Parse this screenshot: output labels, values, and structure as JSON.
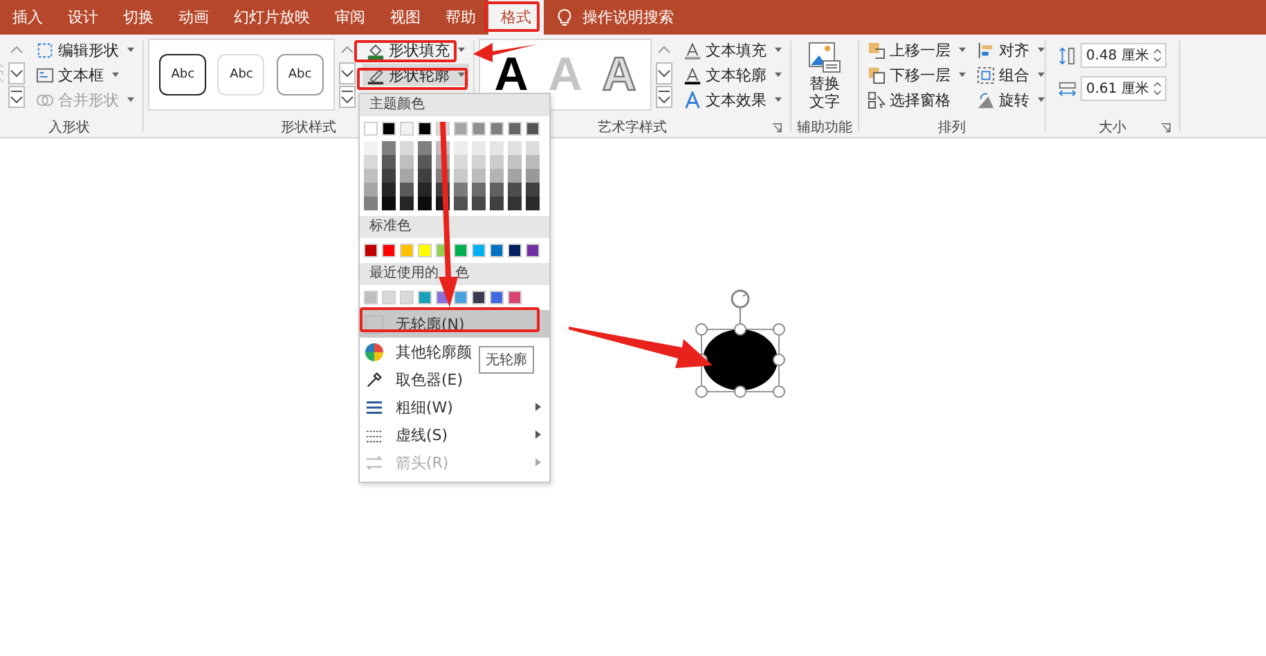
{
  "ribbon_tabs": [
    {
      "label": "插入",
      "selected": false
    },
    {
      "label": "设计",
      "selected": false
    },
    {
      "label": "切换",
      "selected": false
    },
    {
      "label": "动画",
      "selected": false
    },
    {
      "label": "幻灯片放映",
      "selected": false
    },
    {
      "label": "审阅",
      "selected": false
    },
    {
      "label": "视图",
      "selected": false
    },
    {
      "label": "帮助",
      "selected": false
    },
    {
      "label": "格式",
      "selected": true
    }
  ],
  "search": {
    "label": "操作说明搜索"
  },
  "insert_shapes": {
    "label": "入形状",
    "commands": [
      {
        "kind": "edit-shape",
        "label": "编辑形状",
        "disabled": false
      },
      {
        "kind": "text-box",
        "label": "文本框",
        "disabled": false
      },
      {
        "kind": "merge",
        "label": "合并形状",
        "disabled": true
      }
    ]
  },
  "shape_styles": {
    "label": "形状样式",
    "presets": [
      {
        "kind": "bold",
        "label": "Abc"
      },
      {
        "kind": "light",
        "label": "Abc"
      },
      {
        "kind": "medium",
        "label": "Abc"
      }
    ],
    "commands": [
      {
        "kind": "fill",
        "label": "形状填充",
        "selected": false
      },
      {
        "kind": "outline",
        "label": "形状轮廓",
        "selected": true
      }
    ]
  },
  "wordart_styles": {
    "label": "艺术字样式",
    "presets": [
      {
        "kind": "solid",
        "label": "A"
      },
      {
        "kind": "faded",
        "label": "A"
      },
      {
        "kind": "outlined",
        "label": "A"
      }
    ],
    "commands": [
      {
        "kind": "text-fill",
        "label": "文本填充"
      },
      {
        "kind": "text-outline",
        "label": "文本轮廓"
      },
      {
        "kind": "text-effect",
        "label": "文本效果"
      }
    ]
  },
  "accessibility": {
    "label": "辅助功能",
    "command_lines": [
      "替换",
      "文字"
    ]
  },
  "arrange": {
    "label": "排列",
    "commands": [
      {
        "kind": "forward",
        "label": "上移一层",
        "dropdown": true
      },
      {
        "kind": "backward",
        "label": "下移一层",
        "dropdown": true
      },
      {
        "kind": "pane",
        "label": "选择窗格",
        "dropdown": false
      },
      {
        "kind": "align",
        "label": "对齐",
        "dropdown": true
      },
      {
        "kind": "group",
        "label": "组合",
        "dropdown": true
      },
      {
        "kind": "rotate",
        "label": "旋转",
        "dropdown": true
      }
    ]
  },
  "size": {
    "label": "大小",
    "fields": [
      {
        "kind": "height",
        "value": "0.48 厘米"
      },
      {
        "kind": "width",
        "value": "0.61 厘米"
      }
    ]
  },
  "outline_menu": {
    "theme_header": "主题颜色",
    "theme_colors": [
      {
        "color": "#ffffff",
        "shades": [
          {
            "color": "#f2f2f2"
          },
          {
            "color": "#d9d9d9"
          },
          {
            "color": "#bfbfbf"
          },
          {
            "color": "#a6a6a6"
          },
          {
            "color": "#808080"
          }
        ]
      },
      {
        "color": "#000000",
        "shades": [
          {
            "color": "#808080"
          },
          {
            "color": "#595959"
          },
          {
            "color": "#404040"
          },
          {
            "color": "#262626"
          },
          {
            "color": "#0d0d0d"
          }
        ]
      },
      {
        "color": "#f2f2f2",
        "shades": [
          {
            "color": "#d9d9d9"
          },
          {
            "color": "#bfbfbf"
          },
          {
            "color": "#a6a6a6"
          },
          {
            "color": "#595959"
          },
          {
            "color": "#262626"
          }
        ]
      },
      {
        "color": "#000000",
        "shades": [
          {
            "color": "#808080"
          },
          {
            "color": "#595959"
          },
          {
            "color": "#404040"
          },
          {
            "color": "#262626"
          },
          {
            "color": "#0d0d0d"
          }
        ]
      },
      {
        "color": "#d9d9d9",
        "shades": [
          {
            "color": "#bfbfbf"
          },
          {
            "color": "#a6a6a6"
          },
          {
            "color": "#7f7f7f"
          },
          {
            "color": "#404040"
          },
          {
            "color": "#1a1a1a"
          }
        ]
      },
      {
        "color": "#a6a6a6",
        "shades": [
          {
            "color": "#ededed"
          },
          {
            "color": "#dbdbdb"
          },
          {
            "color": "#c9c9c9"
          },
          {
            "color": "#7c7c7c"
          },
          {
            "color": "#525252"
          }
        ]
      },
      {
        "color": "#909090",
        "shades": [
          {
            "color": "#e9e9e9"
          },
          {
            "color": "#d3d3d3"
          },
          {
            "color": "#bcbcbc"
          },
          {
            "color": "#6c6c6c"
          },
          {
            "color": "#484848"
          }
        ]
      },
      {
        "color": "#808080",
        "shades": [
          {
            "color": "#e6e6e6"
          },
          {
            "color": "#cccccc"
          },
          {
            "color": "#b3b3b3"
          },
          {
            "color": "#606060"
          },
          {
            "color": "#404040"
          }
        ]
      },
      {
        "color": "#666666",
        "shades": [
          {
            "color": "#e0e0e0"
          },
          {
            "color": "#c2c2c2"
          },
          {
            "color": "#a3a3a3"
          },
          {
            "color": "#4d4d4d"
          },
          {
            "color": "#333333"
          }
        ]
      },
      {
        "color": "#555555",
        "shades": [
          {
            "color": "#dddddd"
          },
          {
            "color": "#bbbbbb"
          },
          {
            "color": "#999999"
          },
          {
            "color": "#404040"
          },
          {
            "color": "#2a2a2a"
          }
        ]
      }
    ],
    "standard_header": "标准色",
    "standard_colors": [
      {
        "color": "#c00000"
      },
      {
        "color": "#ff0000"
      },
      {
        "color": "#ffc000"
      },
      {
        "color": "#ffff00"
      },
      {
        "color": "#92d050"
      },
      {
        "color": "#00b050"
      },
      {
        "color": "#00b0f0"
      },
      {
        "color": "#0070c0"
      },
      {
        "color": "#002060"
      },
      {
        "color": "#7030a0"
      }
    ],
    "recent_header": "最近使用的",
    "recent_header_tail": "色",
    "recent_colors": [
      {
        "color": "#bfbfbf"
      },
      {
        "color": "#d9d9d9"
      },
      {
        "color": "#d9d9d9"
      },
      {
        "color": "#17a2b8"
      },
      {
        "color": "#8a6fd6"
      },
      {
        "color": "#4aa3df"
      },
      {
        "color": "#3b3b4f"
      },
      {
        "color": "#4169e1"
      },
      {
        "color": "#d9436f"
      }
    ],
    "items": [
      {
        "kind": "none",
        "label": "无轮廓(N)",
        "selected": true,
        "submenu": false,
        "disabled": false
      },
      {
        "kind": "palette",
        "label": "其他轮廓颜",
        "selected": false,
        "submenu": false,
        "disabled": false
      },
      {
        "kind": "eyedropper",
        "label": "取色器(E)",
        "selected": false,
        "submenu": false,
        "disabled": false
      },
      {
        "kind": "weight",
        "label": "粗细(W)",
        "selected": false,
        "submenu": true,
        "disabled": false
      },
      {
        "kind": "dash",
        "label": "虚线(S)",
        "selected": false,
        "submenu": true,
        "disabled": false
      },
      {
        "kind": "arrows",
        "label": "箭头(R)",
        "selected": false,
        "submenu": true,
        "disabled": true
      }
    ]
  },
  "tooltip": {
    "text": "无轮廓"
  }
}
